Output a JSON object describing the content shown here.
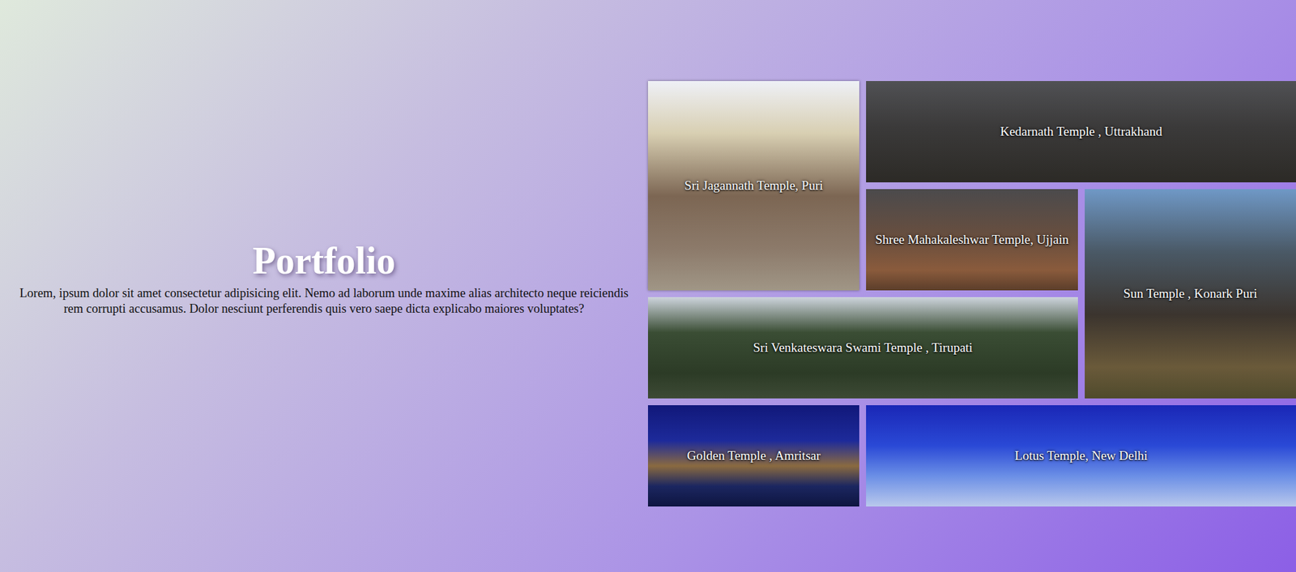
{
  "intro": {
    "title": "Portfolio",
    "text": "Lorem, ipsum dolor sit amet consectetur adipisicing elit. Nemo ad laborum unde maxime alias architecto neque reiciendis rem corrupti accusamus. Dolor nesciunt perferendis quis vero saepe dicta explicabo maiores voluptates?"
  },
  "gallery": [
    {
      "label": "Sri Jagannath Temple, Puri"
    },
    {
      "label": "Kedarnath Temple , Uttrakhand"
    },
    {
      "label": "Shree Mahakaleshwar Temple, Ujjain"
    },
    {
      "label": "Sun Temple , Konark Puri"
    },
    {
      "label": "Sri Venkateswara Swami Temple , Tirupati"
    },
    {
      "label": "Golden Temple , Amritsar"
    },
    {
      "label": "Lotus Temple, New Delhi"
    }
  ]
}
